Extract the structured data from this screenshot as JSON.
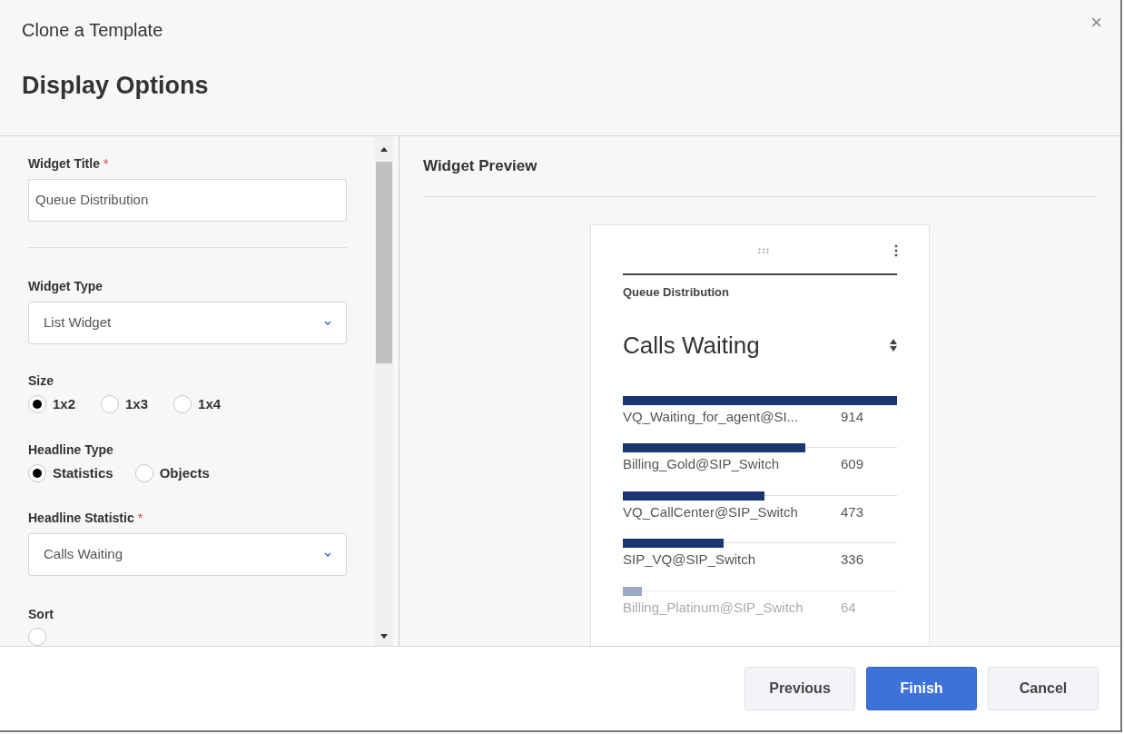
{
  "dialog": {
    "title": "Clone a Template",
    "subtitle": "Display Options",
    "close": "×"
  },
  "form": {
    "widget_title": {
      "label": "Widget Title",
      "required_mark": "*",
      "value": "Queue Distribution"
    },
    "widget_type": {
      "label": "Widget Type",
      "value": "List Widget"
    },
    "size": {
      "label": "Size",
      "options": [
        {
          "label": "1x2",
          "selected": true
        },
        {
          "label": "1x3",
          "selected": false
        },
        {
          "label": "1x4",
          "selected": false
        }
      ]
    },
    "headline_type": {
      "label": "Headline Type",
      "options": [
        {
          "label": "Statistics",
          "selected": true
        },
        {
          "label": "Objects",
          "selected": false
        }
      ]
    },
    "headline_statistic": {
      "label": "Headline Statistic",
      "required_mark": "*",
      "value": "Calls Waiting"
    },
    "sort": {
      "label": "Sort",
      "options": [
        {
          "selected": false
        }
      ]
    }
  },
  "preview": {
    "heading": "Widget Preview",
    "widget_title": "Queue Distribution",
    "headline": "Calls Waiting",
    "rows": [
      {
        "name": "VQ_Waiting_for_agent@SI...",
        "value": "914",
        "level": 1,
        "faded": false
      },
      {
        "name": "Billing_Gold@SIP_Switch",
        "value": "609",
        "level": 0.666,
        "faded": false
      },
      {
        "name": "VQ_CallCenter@SIP_Switch",
        "value": "473",
        "level": 0.518,
        "faded": false
      },
      {
        "name": "SIP_VQ@SIP_Switch",
        "value": "336",
        "level": 0.368,
        "faded": false
      },
      {
        "name": "Billing_Platinum@SIP_Switch",
        "value": "64",
        "level": 0.07,
        "faded": true
      }
    ]
  },
  "buttons": [
    {
      "label": "Previous",
      "kind": "secondary"
    },
    {
      "label": "Finish",
      "kind": "primary"
    },
    {
      "label": "Cancel",
      "kind": "secondary"
    }
  ]
}
